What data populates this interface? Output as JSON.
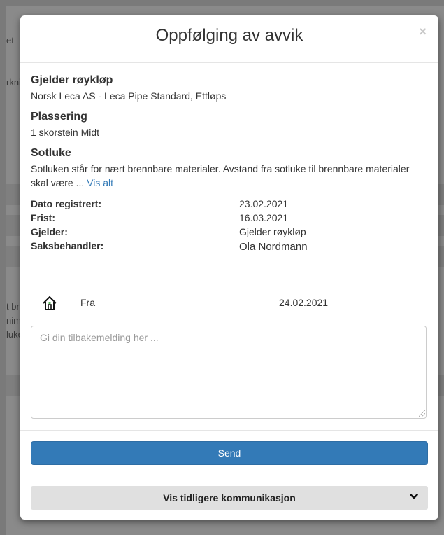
{
  "background": {
    "fragments": [
      "et",
      "rkni",
      "t bre",
      "nim",
      "luke"
    ]
  },
  "modal": {
    "title": "Oppfølging av avvik",
    "close_label": "×"
  },
  "details": {
    "applies_to_title": "Gjelder røykløp",
    "applies_to_value": "Norsk Leca AS - Leca Pipe Standard, Ettløps",
    "location_title": "Plassering",
    "location_value": "1 skorstein Midt",
    "item_title": "Sotluke",
    "description": "Sotluken står for nært brennbare materialer. Avstand fra sotluke til brennbare materialer skal være ...",
    "show_all_link": "Vis alt"
  },
  "meta": {
    "registered_label": "Dato registrert:",
    "registered_value": "23.02.2021",
    "deadline_label": "Frist:",
    "deadline_value": "16.03.2021",
    "applies_label": "Gjelder:",
    "applies_value": "Gjelder røykløp",
    "handler_label": "Saksbehandler:",
    "handler_value": "Ola Nordmann"
  },
  "communication": {
    "from_label": "Fra",
    "from_date": "24.02.2021",
    "icon": "house-icon",
    "icon_color": "#5cb85c"
  },
  "form": {
    "placeholder": "Gi din tilbakemelding her ...",
    "send_label": "Send",
    "history_label": "Vis tidligere kommunikasjon"
  },
  "colors": {
    "primary": "#337ab7",
    "link": "#337ab7"
  }
}
